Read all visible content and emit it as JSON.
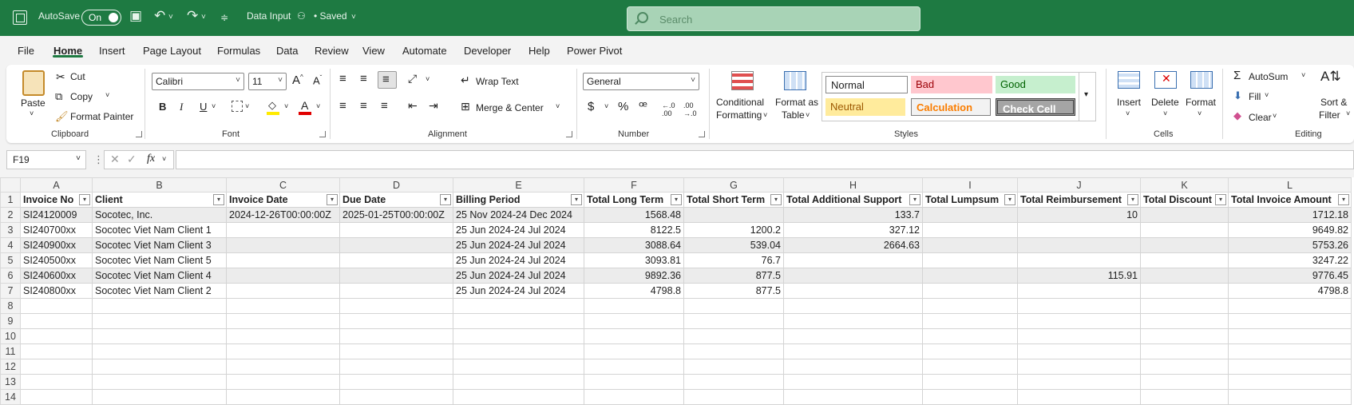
{
  "titlebar": {
    "autosave": "AutoSave",
    "toggle": "On",
    "doc_name": "Data Input",
    "saved": "• Saved",
    "search_placeholder": "Search"
  },
  "menu": [
    "File",
    "Home",
    "Insert",
    "Page Layout",
    "Formulas",
    "Data",
    "Review",
    "View",
    "Automate",
    "Developer",
    "Help",
    "Power Pivot"
  ],
  "ribbon": {
    "clipboard": {
      "paste": "Paste",
      "cut": "Cut",
      "copy": "Copy",
      "format_painter": "Format Painter",
      "label": "Clipboard"
    },
    "font": {
      "name": "Calibri",
      "size": "11",
      "label": "Font",
      "bold": "B",
      "italic": "I",
      "underline": "U",
      "font_color": "A"
    },
    "alignment": {
      "wrap": "Wrap Text",
      "merge": "Merge & Center",
      "label": "Alignment"
    },
    "number": {
      "format": "General",
      "label": "Number"
    },
    "styles": {
      "conditional": "Conditional",
      "conditional2": "Formatting",
      "format_as": "Format as",
      "table": "Table",
      "label": "Styles",
      "normal": "Normal",
      "bad": "Bad",
      "good": "Good",
      "neutral": "Neutral",
      "calculation": "Calculation",
      "check_cell": "Check Cell"
    },
    "cells": {
      "insert": "Insert",
      "delete": "Delete",
      "format": "Format",
      "label": "Cells"
    },
    "editing": {
      "autosum": "AutoSum",
      "fill": "Fill",
      "clear": "Clear",
      "sort": "Sort &",
      "filter": "Filter",
      "label": "Editing"
    }
  },
  "formula_bar": {
    "name_box": "F19",
    "fx": "fx",
    "content": ""
  },
  "sheet": {
    "columns": [
      "A",
      "B",
      "C",
      "D",
      "E",
      "F",
      "G",
      "H",
      "I",
      "J",
      "K",
      "L"
    ],
    "headers": [
      "Invoice No",
      "Client",
      "Invoice Date",
      "Due Date",
      "Billing Period",
      "Total Long Term",
      "Total Short Term",
      "Total Additional Support",
      "Total Lumpsum",
      "Total Reimbursement",
      "Total Discount",
      "Total Invoice Amount"
    ],
    "rows": [
      [
        "SI24120009",
        "Socotec, Inc.",
        "2024-12-26T00:00:00Z",
        "2025-01-25T00:00:00Z",
        "25 Nov 2024-24 Dec 2024",
        "1568.48",
        "",
        "133.7",
        "",
        "10",
        "",
        "1712.18"
      ],
      [
        "SI240700xx",
        "Socotec Viet Nam Client 1",
        "",
        "",
        "25 Jun 2024-24 Jul 2024",
        "8122.5",
        "1200.2",
        "327.12",
        "",
        "",
        "",
        "9649.82"
      ],
      [
        "SI240900xx",
        "Socotec Viet Nam Client 3",
        "",
        "",
        "25 Jun 2024-24 Jul 2024",
        "3088.64",
        "539.04",
        "2664.63",
        "",
        "",
        "",
        "5753.26"
      ],
      [
        "SI240500xx",
        "Socotec Viet Nam Client 5",
        "",
        "",
        "25 Jun 2024-24 Jul 2024",
        "3093.81",
        "76.7",
        "",
        "",
        "",
        "",
        "3247.22"
      ],
      [
        "SI240600xx",
        "Socotec Viet Nam Client 4",
        "",
        "",
        "25 Jun 2024-24 Jul 2024",
        "9892.36",
        "877.5",
        "",
        "",
        "115.91",
        "",
        "9776.45"
      ],
      [
        "SI240800xx",
        "Socotec Viet Nam Client 2",
        "",
        "",
        "25 Jun 2024-24 Jul 2024",
        "4798.8",
        "877.5",
        "",
        "",
        "",
        "",
        "4798.8"
      ]
    ],
    "row_numbers": [
      "1",
      "2",
      "3",
      "4",
      "5",
      "6",
      "7",
      "8",
      "9",
      "10",
      "11",
      "12",
      "13",
      "14"
    ]
  }
}
